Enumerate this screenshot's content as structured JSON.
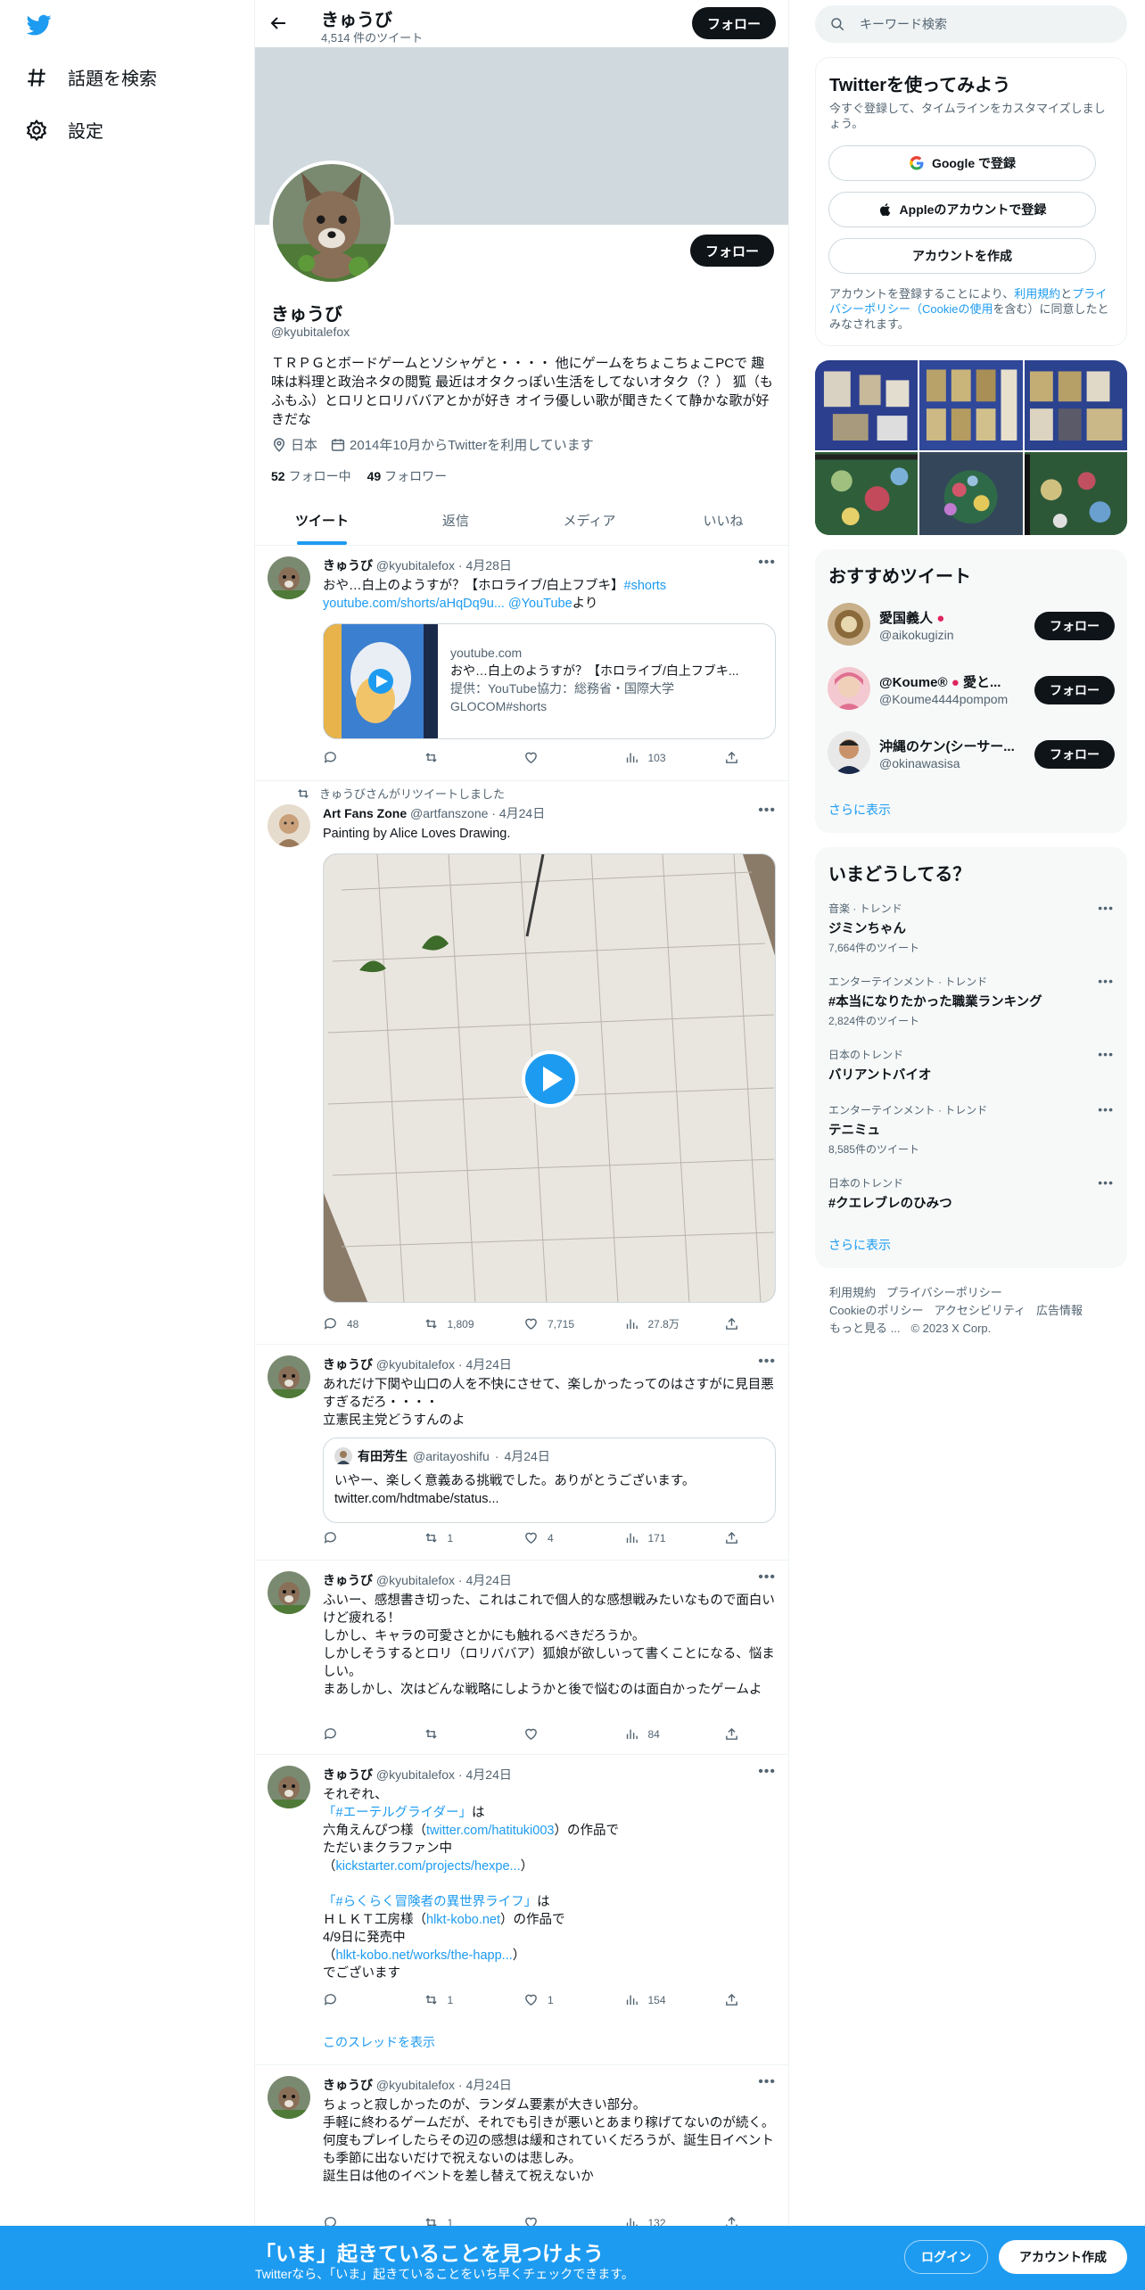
{
  "nav": {
    "explore": "話題を検索",
    "settings": "設定"
  },
  "header": {
    "name": "きゅうび",
    "tweet_count": "4,514 件のツイート",
    "follow": "フォロー"
  },
  "profile": {
    "name": "きゅうび",
    "handle": "@kyubitalefox",
    "bio": "ＴＲＰＧとボードゲームとソシャゲと・・・・ 他にゲームをちょこちょこPCで 趣味は料理と政治ネタの閲覧 最近はオタクっぽい生活をしてないオタク（？） 狐（もふもふ）とロリとロリババアとかが好き オイラ優しい歌が聞きたくて静かな歌が好きだな",
    "location": "日本",
    "joined": "2014年10月からTwitterを利用しています",
    "following_count": "52",
    "following_label": "フォロー中",
    "followers_count": "49",
    "followers_label": "フォロワー",
    "follow": "フォロー"
  },
  "tabs": [
    "ツイート",
    "返信",
    "メディア",
    "いいね"
  ],
  "tweets": [
    {
      "name": "きゅうび",
      "handle": "@kyubitalefox",
      "date": "4月28日",
      "text_pre": "おや…白上のようすが？【ホロライブ/白上フブキ】",
      "hashtag": "#shorts",
      "link": "youtube.com/shorts/aHqDq9u...",
      "via": "@YouTube",
      "via_suffix": "より",
      "card": {
        "domain": "youtube.com",
        "title": "おや…白上のようすが？【ホロライブ/白上フブキ...",
        "desc": "提供：YouTube協力：総務省・国際大学GLOCOM#shorts"
      },
      "views": "103"
    },
    {
      "retweet_note": "きゅうびさんがリツイートしました",
      "name": "Art Fans Zone",
      "handle": "@artfanszone",
      "date": "4月24日",
      "text": "Painting by Alice Loves Drawing.",
      "replies": "48",
      "retweets": "1,809",
      "likes": "7,715",
      "views": "27.8万"
    },
    {
      "name": "きゅうび",
      "handle": "@kyubitalefox",
      "date": "4月24日",
      "text": "あれだけ下関や山口の人を不快にさせて、楽しかったってのはさすがに見目悪すぎるだろ・・・・\n立憲民主党どうすんのよ",
      "quote": {
        "name": "有田芳生",
        "handle": "@aritayoshifu",
        "date": "4月24日",
        "text": "いやー、楽しく意義ある挑戦でした。ありがとうございます。",
        "link": "twitter.com/hdtmabe/status..."
      },
      "retweets": "1",
      "likes": "4",
      "views": "171"
    },
    {
      "name": "きゅうび",
      "handle": "@kyubitalefox",
      "date": "4月24日",
      "text": "ふいー、感想書き切った、これはこれで個人的な感想戦みたいなもので面白いけど疲れる！\nしかし、キャラの可愛さとかにも触れるべきだろうか。\nしかしそうするとロリ（ロリババア）狐娘が欲しいって書くことになる、悩ましい。\nまあしかし、次はどんな戦略にしようかと後で悩むのは面白かったゲームよ",
      "views": "84"
    },
    {
      "name": "きゅうび",
      "handle": "@kyubitalefox",
      "date": "4月24日",
      "l1": "それぞれ、",
      "l2": "「#エーテルグライダー」",
      "l2b": "は",
      "l3a": "六角えんぴつ様（",
      "l3link": "twitter.com/hatituki003",
      "l3b": "）の作品で",
      "l4": "ただいまクラファン中",
      "l5a": "（",
      "l5link": "kickstarter.com/projects/hexpe...",
      "l5b": "）",
      "l6": "「#らくらく冒険者の異世界ライフ」",
      "l6b": "は",
      "l7a": "ＨＬＫＴ工房様（",
      "l7link": "hlkt-kobo.net",
      "l7b": "）の作品で",
      "l8": "4/9日に発売中",
      "l9a": "（",
      "l9link": "hlkt-kobo.net/works/the-happ...",
      "l9b": "）",
      "l10": "でございます",
      "retweets": "1",
      "likes": "1",
      "views": "154",
      "thread": "このスレッドを表示"
    },
    {
      "name": "きゅうび",
      "handle": "@kyubitalefox",
      "date": "4月24日",
      "text": "ちょっと寂しかったのが、ランダム要素が大きい部分。\n手軽に終わるゲームだが、それでも引きが悪いとあまり稼げてないのが続く。\n何度もプレイしたらその辺の感想は緩和されていくだろうが、誕生日イベントも季節に出ないだけで祝えないのは悲しみ。\n誕生日は他のイベントを差し替えて祝えないか",
      "retweets": "1",
      "views": "132"
    }
  ],
  "search": {
    "placeholder": "キーワード検索"
  },
  "signup": {
    "title": "Twitterを使ってみよう",
    "subtitle": "今すぐ登録して、タイムラインをカスタマイズしましょう。",
    "google": "Google で登録",
    "apple": "Appleのアカウントで登録",
    "create": "アカウントを作成",
    "terms_1": "アカウントを登録することにより、",
    "terms_link1": "利用規約",
    "terms_2": "と",
    "terms_link2": "プライバシーポリシー（Cookieの使用",
    "terms_3": "を含む）に同意したとみなされます。"
  },
  "recommended": {
    "title": "おすすめツイート",
    "users": [
      {
        "name": "愛国義人",
        "handle": "@aikokugizin",
        "button": "フォロー"
      },
      {
        "name": "@Koume®",
        "name_extra": "愛と...",
        "handle": "@Koume4444pompom",
        "button": "フォロー"
      },
      {
        "name": "沖縄のケン(シーサー...",
        "handle": "@okinawasisa",
        "button": "フォロー"
      }
    ],
    "more": "さらに表示"
  },
  "trends": {
    "title": "いまどうしてる？",
    "items": [
      {
        "category": "音楽 · トレンド",
        "name": "ジミンちゃん",
        "count": "7,664件のツイート"
      },
      {
        "category": "エンターテインメント · トレンド",
        "name": "#本当になりたかった職業ランキング",
        "count": "2,824件のツイート"
      },
      {
        "category": "日本のトレンド",
        "name": "バリアントバイオ",
        "count": ""
      },
      {
        "category": "エンターテインメント · トレンド",
        "name": "テニミュ",
        "count": "8,585件のツイート"
      },
      {
        "category": "日本のトレンド",
        "name": "#クエレブレのひみつ",
        "count": ""
      }
    ],
    "more": "さらに表示"
  },
  "footer": {
    "terms": "利用規約",
    "privacy": "プライバシーポリシー",
    "cookie": "Cookieのポリシー",
    "access": "アクセシビリティ",
    "ads": "広告情報",
    "more": "もっと見る ...",
    "copyright": "© 2023 X Corp."
  },
  "bottombar": {
    "title": "「いま」起きていることを見つけよう",
    "subtitle": "Twitterなら、「いま」起きていることをいち早くチェックできます。",
    "login": "ログイン",
    "signup": "アカウント作成"
  },
  "colors": {
    "accent": "#1d9bf0",
    "text": "#0f1419",
    "secondary": "#536471"
  }
}
